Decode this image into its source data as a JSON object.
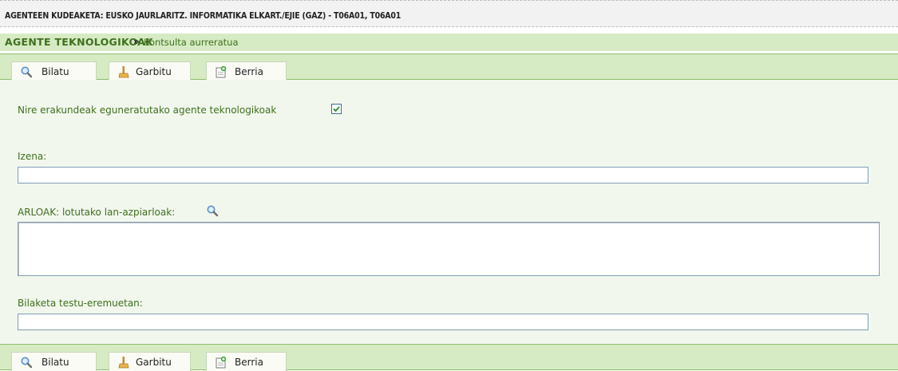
{
  "header": {
    "title": "AGENTEEN KUDEAKETA: EUSKO JAURLARITZ. INFORMATIKA ELKART./EJIE (GAZ) - T06A01, T06A01"
  },
  "breadcrumb": {
    "section": "AGENTE TEKNOLOGIKOAK",
    "separator": "»",
    "page": "Kontsulta aurreratua"
  },
  "toolbar": {
    "search_label": "Bilatu",
    "clear_label": "Garbitu",
    "new_label": "Berria",
    "search_icon": "magnifier-icon",
    "clear_icon": "broom-icon",
    "new_icon": "new-document-icon"
  },
  "form": {
    "own_agents_label": "Nire erakundeak eguneratutako agente teknologikoak",
    "own_agents_checked": true,
    "name_label": "Izena:",
    "name_value": "",
    "areas_label": "ARLOAK: lotutako lan-azpiarloak:",
    "areas_value": "",
    "text_search_label": "Bilaketa testu-eremuetan:",
    "text_search_value": ""
  },
  "colors": {
    "accent_green": "#3f6f1d",
    "bar_green": "#d6ebc4",
    "form_bg": "#f2f7ee",
    "input_border": "#7f9db9"
  }
}
